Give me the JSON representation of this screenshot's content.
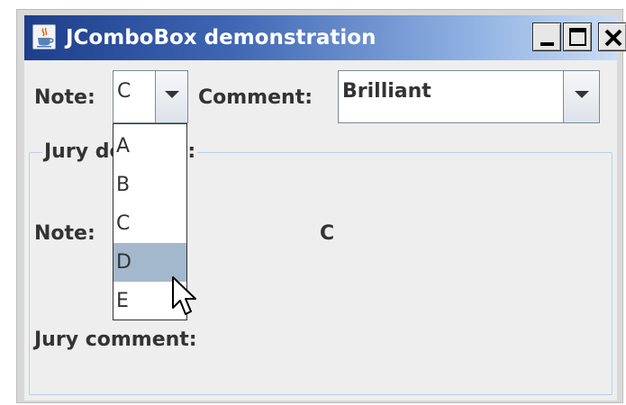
{
  "window": {
    "title": "JComboBox demonstration",
    "icon": "java-coffee-cup-icon",
    "controls": [
      "minimize-icon",
      "maximize-icon",
      "close-icon"
    ]
  },
  "top_row": {
    "note_label": "Note:",
    "note_value": "C",
    "comment_label": "Comment:",
    "comment_value": "Brilliant"
  },
  "jury": {
    "title": "Jury decision:",
    "note_label": "Note:",
    "note_value": "C",
    "comment_label": "Jury comment:"
  },
  "note_popup": {
    "items": [
      "A",
      "B",
      "C",
      "D",
      "E"
    ],
    "highlighted": "D"
  },
  "colors": {
    "title_gradient_start": "#1d3e8b",
    "title_gradient_end": "#c9dcf4",
    "selection": "#a3b8cc",
    "panel_background": "#eeeeee"
  }
}
